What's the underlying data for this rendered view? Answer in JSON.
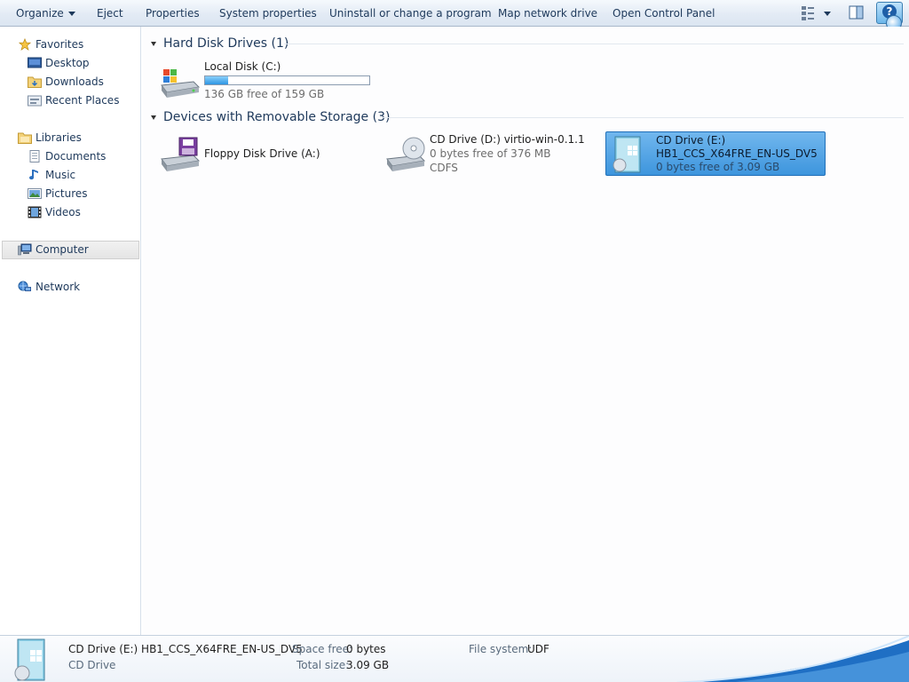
{
  "toolbar": {
    "organize": "Organize",
    "eject": "Eject",
    "properties": "Properties",
    "system_properties": "System properties",
    "uninstall": "Uninstall or change a program",
    "map_network": "Map network drive",
    "open_control_panel": "Open Control Panel"
  },
  "nav": {
    "favorites": "Favorites",
    "desktop": "Desktop",
    "downloads": "Downloads",
    "recent_places": "Recent Places",
    "libraries": "Libraries",
    "documents": "Documents",
    "music": "Music",
    "pictures": "Pictures",
    "videos": "Videos",
    "computer": "Computer",
    "network": "Network"
  },
  "groups": {
    "hard_disk": "Hard Disk Drives (1)",
    "removable": "Devices with Removable Storage (3)"
  },
  "drives": {
    "c": {
      "name": "Local Disk (C:)",
      "free": "136 GB free of 159 GB",
      "used_fraction": 0.14
    },
    "a": {
      "name": "Floppy Disk Drive (A:)"
    },
    "d": {
      "name": "CD Drive (D:) virtio-win-0.1.1",
      "free": "0 bytes free of 376 MB",
      "fs": "CDFS"
    },
    "e": {
      "name": "CD Drive (E:)",
      "label": "HB1_CCS_X64FRE_EN-US_DV5",
      "free": "0 bytes free of 3.09 GB"
    }
  },
  "details": {
    "title": "CD Drive (E:) HB1_CCS_X64FRE_EN-US_DV5",
    "type": "CD Drive",
    "space_free_label": "Space free:",
    "space_free_value": "0 bytes",
    "total_size_label": "Total size:",
    "total_size_value": "3.09 GB",
    "fs_label": "File system:",
    "fs_value": "UDF"
  },
  "colors": {
    "accent": "#3d95dd",
    "text": "#1e395b",
    "selection": "#71b7ee"
  }
}
